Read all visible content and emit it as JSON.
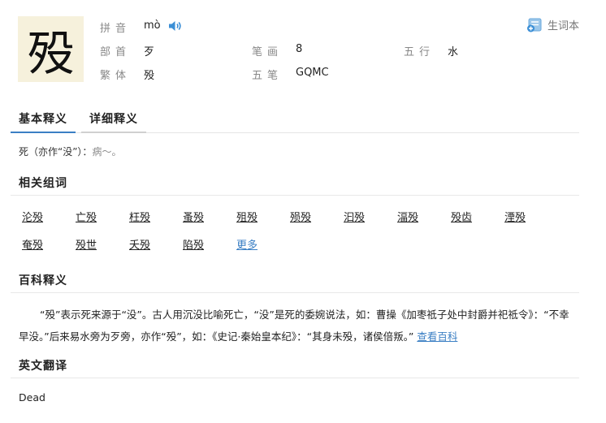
{
  "character": "殁",
  "info": {
    "pinyin_label": "拼音",
    "pinyin_value": "mò",
    "bushou_label": "部首",
    "bushou_value": "歹",
    "bihua_label": "笔画",
    "bihua_value": "8",
    "wuxing_label": "五行",
    "wuxing_value": "水",
    "fanti_label": "繁体",
    "fanti_value": "殁",
    "wubi_label": "五笔",
    "wubi_value": "GQMC"
  },
  "vocab_button": "生词本",
  "tabs": [
    "基本释义",
    "详细释义"
  ],
  "basic_definition": {
    "main": "死（亦作“没”）：",
    "example": "病～。"
  },
  "related_words": {
    "title": "相关组词",
    "row1": [
      "沦殁",
      "亡殁",
      "枉殁",
      "蚤殁",
      "殂殁",
      "殒殁",
      "汩殁",
      "湢殁",
      "殁齿",
      "湮殁"
    ],
    "row2": [
      "奄殁",
      "殁世",
      "夭殁",
      "陷殁"
    ],
    "more": "更多"
  },
  "baike": {
    "title": "百科释义",
    "text": "“殁”表示死来源于“没”。古人用沉没比喻死亡，“没”是死的委婉说法，如：曹操《加枣祗子处中封爵并祀祗令》：“不幸早没。”后来易水旁为歹旁，亦作“殁”，如：《史记·秦始皇本纪》：“其身未殁，诸侯倍叛。”",
    "link": "查看百科"
  },
  "english": {
    "title": "英文翻译",
    "text": "Dead"
  }
}
